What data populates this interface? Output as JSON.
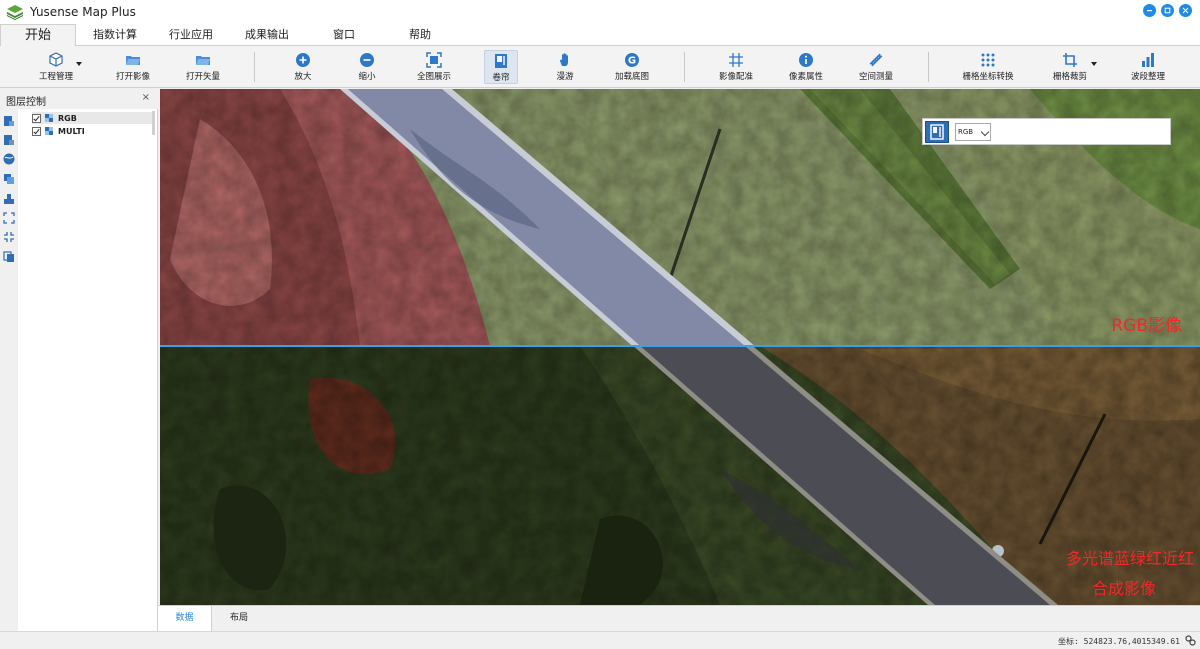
{
  "app": {
    "title": "Yusense Map Plus"
  },
  "menu": {
    "tabs": [
      {
        "label": "开始",
        "active": true
      },
      {
        "label": "指数计算"
      },
      {
        "label": "行业应用"
      },
      {
        "label": "成果输出"
      },
      {
        "label": "窗口"
      },
      {
        "label": "帮助"
      }
    ]
  },
  "toolbar": {
    "project": "工程管理",
    "open_image": "打开影像",
    "open_vector": "打开矢量",
    "zoom_in": "放大",
    "zoom_out": "缩小",
    "full_extent": "全图展示",
    "swipe": "卷帘",
    "pan": "漫游",
    "load_basemap": "加载底图",
    "image_registration": "影像配准",
    "pixel_attribute": "像素属性",
    "spatial_measure": "空间测量",
    "raster_coord_convert": "栅格坐标转换",
    "raster_clip": "栅格裁剪",
    "band_arrange": "波段整理"
  },
  "layer_panel": {
    "title": "图层控制",
    "close": "×",
    "layers": [
      {
        "name": "RGB",
        "checked": true,
        "selected": true
      },
      {
        "name": "MULTI",
        "checked": true,
        "selected": false
      }
    ]
  },
  "map": {
    "label_top": "RGB影像",
    "label_bottom_line1": "多光谱蓝绿红近红",
    "label_bottom_line2": "合成影像",
    "swipe_layer": "RGB"
  },
  "view_tabs": [
    {
      "label": "数据",
      "active": true
    },
    {
      "label": "布局",
      "active": false
    }
  ],
  "status": {
    "coord_label": "坐标:",
    "coord_value": "524823.76,4015349.61"
  },
  "colors": {
    "accent": "#1e8ce6",
    "label_red": "#ee2a2a",
    "swipe_line": "#3aa0e8"
  }
}
